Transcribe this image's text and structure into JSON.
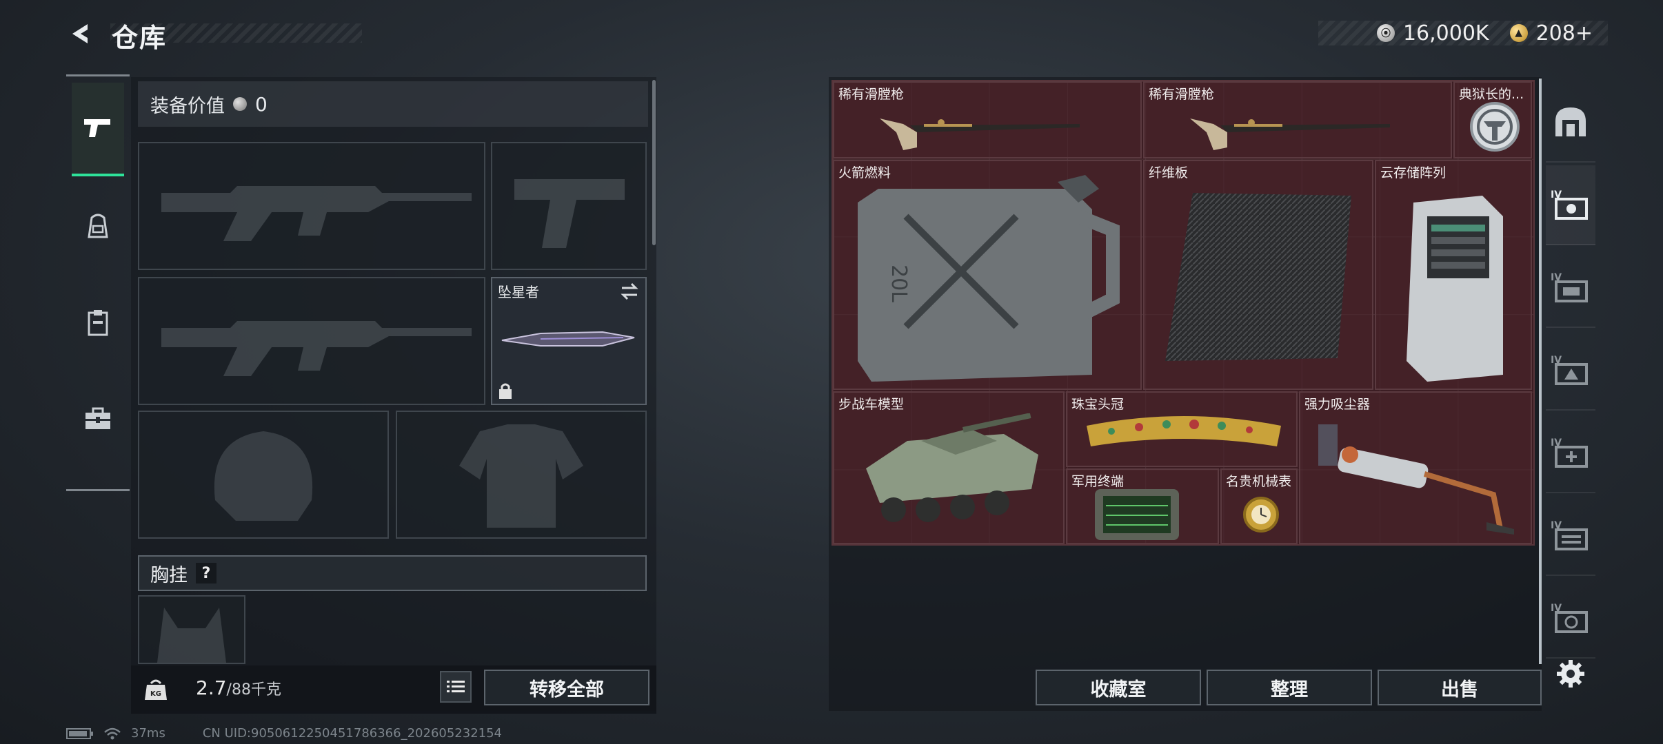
{
  "header": {
    "title": "仓库",
    "silver_amount": "16,000K",
    "gold_amount": "208+"
  },
  "left_tabs": [
    {
      "name": "weapons",
      "icon": "pistol-icon",
      "active": true
    },
    {
      "name": "gear",
      "icon": "backpack-icon",
      "active": false
    },
    {
      "name": "storage",
      "icon": "clipboard-icon",
      "active": false
    },
    {
      "name": "case",
      "icon": "briefcase-icon",
      "active": false
    }
  ],
  "equipment": {
    "value_label": "装备价值",
    "value": "0",
    "slots": [
      {
        "id": "primary-weapon-1",
        "label": "",
        "placeholder": "rifle-silhouette"
      },
      {
        "id": "pistol",
        "label": "",
        "placeholder": "pistol-silhouette"
      },
      {
        "id": "primary-weapon-2",
        "label": "",
        "placeholder": "rifle-silhouette"
      },
      {
        "id": "melee",
        "label": "坠星者",
        "placeholder": "knife",
        "locked": true
      },
      {
        "id": "helmet",
        "label": "",
        "placeholder": "helmet-silhouette"
      },
      {
        "id": "armor",
        "label": "",
        "placeholder": "armor-silhouette"
      }
    ],
    "chest_rig_label": "胸挂",
    "chest_rig_help": "?"
  },
  "weight": {
    "current": "2.7",
    "total": "/88千克"
  },
  "buttons": {
    "transfer_all": "转移全部",
    "collection": "收藏室",
    "organize": "整理",
    "sell": "出售"
  },
  "stash_items": [
    {
      "id": "musket-1",
      "name": "稀有滑膛枪"
    },
    {
      "id": "musket-2",
      "name": "稀有滑膛枪"
    },
    {
      "id": "warden-badge",
      "name": "典狱长的..."
    },
    {
      "id": "rocket-fuel",
      "name": "火箭燃料"
    },
    {
      "id": "fiber-board",
      "name": "纤维板"
    },
    {
      "id": "cloud-storage",
      "name": "云存储阵列"
    },
    {
      "id": "ifv-model",
      "name": "步战车模型"
    },
    {
      "id": "jewel-crown",
      "name": "珠宝头冠"
    },
    {
      "id": "military-terminal",
      "name": "军用终端"
    },
    {
      "id": "luxury-watch",
      "name": "名贵机械表"
    },
    {
      "id": "vacuum",
      "name": "强力吸尘器"
    }
  ],
  "right_tabs": [
    {
      "icon": "safe-icon",
      "level": ""
    },
    {
      "icon": "stash-iv-1-icon",
      "level": "IV"
    },
    {
      "icon": "stash-iv-2-icon",
      "level": "IV"
    },
    {
      "icon": "stash-iv-3-icon",
      "level": "IV"
    },
    {
      "icon": "stash-iv-4-icon",
      "level": "IV"
    },
    {
      "icon": "stash-iv-5-icon",
      "level": "IV"
    },
    {
      "icon": "stash-iv-6-icon",
      "level": "IV"
    },
    {
      "icon": "settings-icon",
      "level": ""
    }
  ],
  "status": {
    "ping": "37ms",
    "uid": "CN UID:9050612250451786366_202605232154"
  },
  "colors": {
    "accent_green": "#2ee39a",
    "stash_red": "#3c1d23"
  }
}
